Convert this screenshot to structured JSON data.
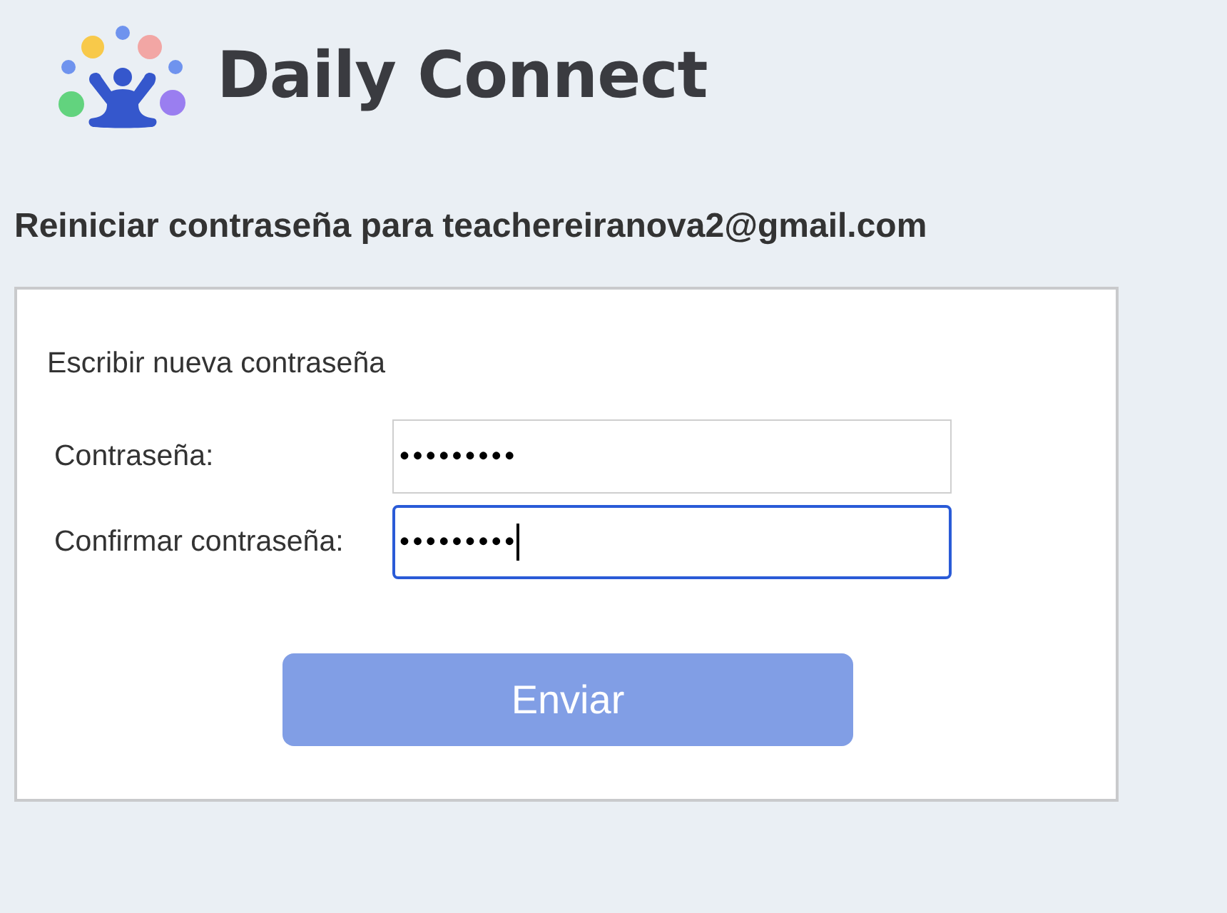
{
  "header": {
    "brand": "Daily Connect"
  },
  "title": "Reiniciar contraseña para teachereiranova2@gmail.com",
  "form": {
    "heading": "Escribir nueva contraseña",
    "fields": [
      {
        "label": "Contraseña:",
        "value": "•••••••••",
        "focused": false
      },
      {
        "label": "Confirmar contraseña:",
        "value": "•••••••••",
        "focused": true
      }
    ],
    "submit": {
      "label": "Enviar",
      "disabled": true
    }
  }
}
